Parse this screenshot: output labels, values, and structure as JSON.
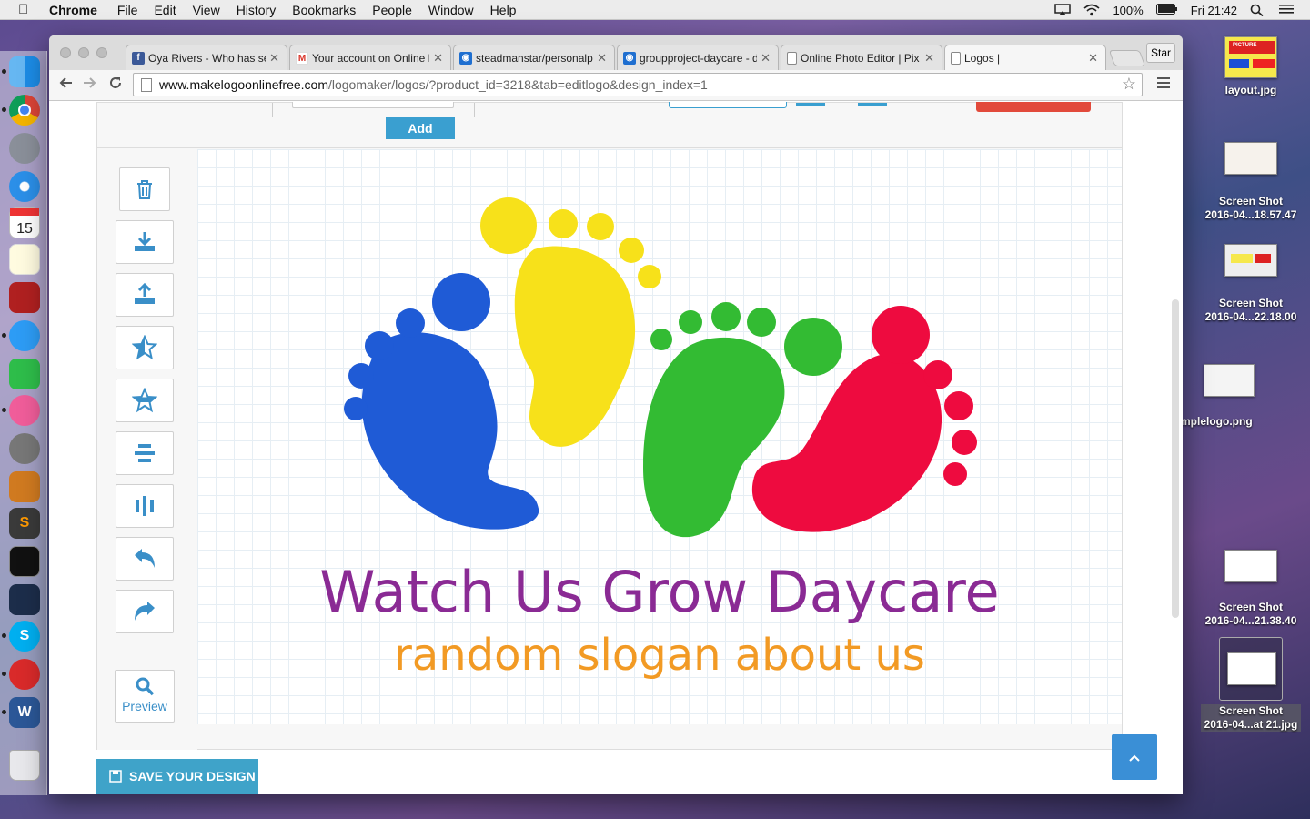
{
  "menubar": {
    "app_name": "Chrome",
    "items": [
      "File",
      "Edit",
      "View",
      "History",
      "Bookmarks",
      "People",
      "Window",
      "Help"
    ],
    "battery": "100%",
    "clock": "Fri 21:42"
  },
  "browser": {
    "tabs": [
      {
        "title": "Oya Rivers - Who has se",
        "favicon": "facebook-icon",
        "color": "#3b5998"
      },
      {
        "title": "Your account on Online L",
        "favicon": "gmail-icon",
        "color": "#d93025"
      },
      {
        "title": "steadmanstar/personalp",
        "favicon": "github-icon",
        "color": "#1f6fd0"
      },
      {
        "title": "groupproject-daycare - d",
        "favicon": "github-icon",
        "color": "#1f6fd0"
      },
      {
        "title": "Online Photo Editor | Pix",
        "favicon": "page-icon",
        "color": "#888888"
      },
      {
        "title": "Logos |",
        "favicon": "page-icon",
        "color": "#888888"
      }
    ],
    "profile_button": "Star",
    "url_host": "www.makelogoonlinefree.com",
    "url_path": "/logomaker/logos/?product_id=3218&tab=editlogo&design_index=1"
  },
  "editor": {
    "add_label": "Add",
    "tools": [
      {
        "name": "delete-icon"
      },
      {
        "name": "download-icon"
      },
      {
        "name": "upload-icon"
      },
      {
        "name": "bring-front-icon"
      },
      {
        "name": "send-back-icon"
      },
      {
        "name": "align-horizontal-icon"
      },
      {
        "name": "align-vertical-icon"
      },
      {
        "name": "undo-icon"
      },
      {
        "name": "redo-icon"
      }
    ],
    "preview_label": "Preview",
    "logo": {
      "title": "Watch Us Grow Daycare",
      "slogan": "random slogan about us",
      "title_color": "#8a2a94",
      "slogan_color": "#f29a24",
      "foot_colors": [
        "#1f5bd6",
        "#f7e11a",
        "#33bb33",
        "#ee0b3f"
      ]
    },
    "save_label": "SAVE YOUR DESIGN"
  },
  "desktop": {
    "icons": [
      {
        "label": "layout.jpg",
        "thumb_text": "PICTURE"
      },
      {
        "label1": "Screen Shot",
        "label2": "2016-04...18.57.47"
      },
      {
        "label1": "Screen Shot",
        "label2": "2016-04...22.18.00"
      },
      {
        "label": "mplelogo.png"
      },
      {
        "label1": "Screen Shot",
        "label2": "2016-04...21.38.40"
      },
      {
        "label1": "Screen Shot",
        "label2": "2016-04...at 21.jpg"
      }
    ]
  }
}
